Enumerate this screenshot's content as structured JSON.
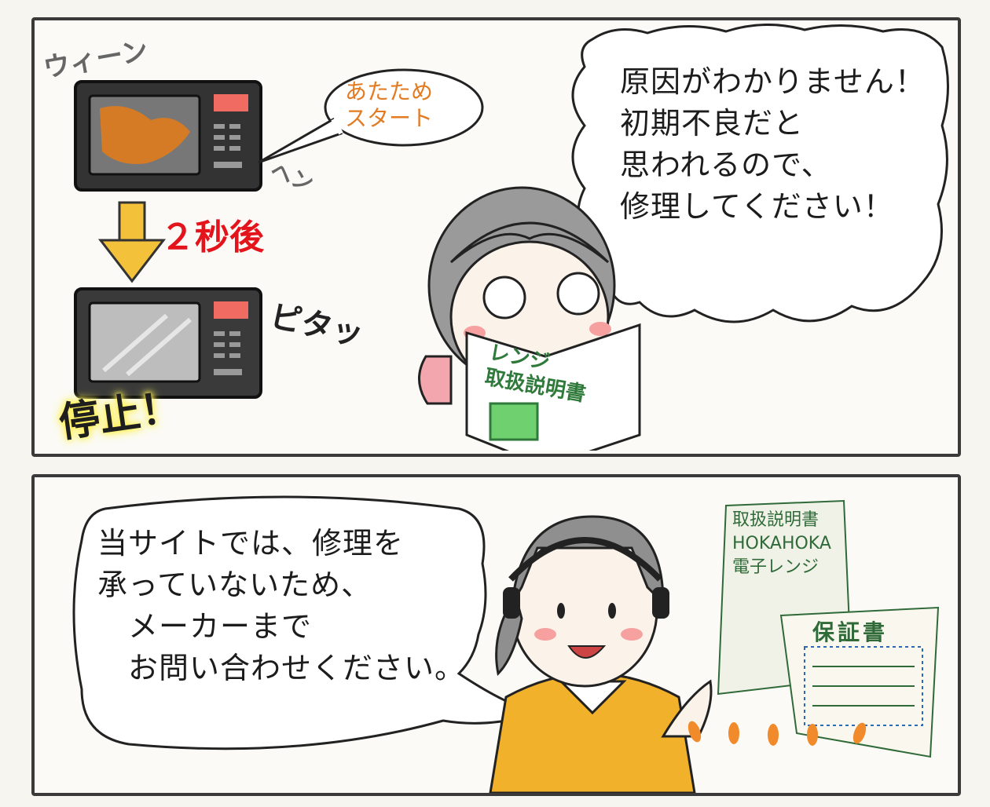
{
  "panel1": {
    "microwave_bubble": "あたため\nスタート",
    "time_caption": "２秒後",
    "sfx_whir": "ウィーン",
    "sfx_whir2": "ヘン",
    "sfx_stop": "ピタッ",
    "stopped_label": "停止！",
    "customer_speech": "原因がわかりません！\n初期不良だと\n思われるので、\n修理してください！",
    "manual_title": "レンジ\n取扱説明書"
  },
  "panel2": {
    "operator_speech": "当サイトでは、修理を\n承っていないため、\n　メーカーまで\n　お問い合わせください。",
    "manual_doc": "取扱説明書\nHOKAHOKA\n電子レンジ",
    "warranty_title": "保証書"
  },
  "colors": {
    "ink": "#1c1c1c",
    "orange": "#e27b22",
    "red": "#e3141b",
    "highlight": "#fff25a",
    "shirt": "#f2b12a",
    "green": "#2f7a3a"
  }
}
